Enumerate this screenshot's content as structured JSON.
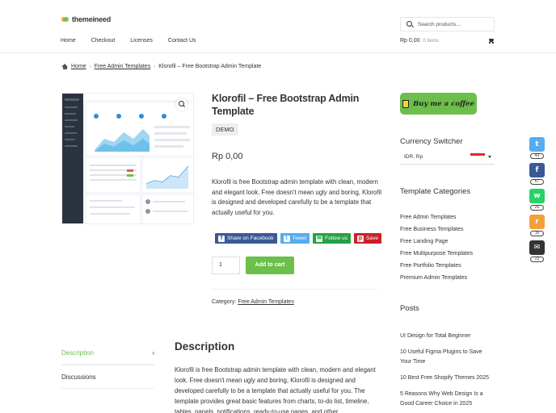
{
  "header": {
    "logo_text": "themeineed",
    "search_placeholder": "Search products…",
    "nav": [
      "Home",
      "Checkout",
      "Licenses",
      "Contact Us"
    ],
    "cart_price": "Rp 0,00",
    "cart_items": "0 items"
  },
  "breadcrumb": {
    "home": "Home",
    "parent": "Free Admin Templates",
    "current": "Klorofil – Free Bootstrap Admin Template",
    "separator": "›"
  },
  "product": {
    "title": "Klorofil – Free Bootstrap Admin Template",
    "demo_label": "DEMO",
    "price": "Rp 0,00",
    "description": "Klorofil is free Bootstrap admin template with clean, modern and elegant look. Free doesn't mean ugly and boring, Klorofil is designed and developed carefully to be a template that actually useful for you.",
    "quantity": "1",
    "add_to_cart": "Add to cart",
    "category_label": "Category:",
    "category_link": "Free Admin Templates",
    "shares": [
      {
        "label": "Share on Facebook",
        "icon": "f",
        "color": "#3b5998"
      },
      {
        "label": "Tweet",
        "icon": "t",
        "color": "#55acee"
      },
      {
        "label": "Follow us",
        "icon": "✉",
        "color": "#25a244"
      },
      {
        "label": "Save",
        "icon": "p",
        "color": "#cb2027"
      }
    ]
  },
  "sidebar": {
    "coffee": "Buy me a coffee",
    "currency_heading": "Currency Switcher",
    "currency_value": "IDR, Rp",
    "categories_heading": "Template Categories",
    "categories": [
      "Free Admin Templates",
      "Free Business Templates",
      "Free Landing Page",
      "Free Multipurpose Templates",
      "Free Portfolio Templates",
      "Premium Admin Templates"
    ],
    "posts_heading": "Posts",
    "posts": [
      "UI Design for Total Beginner",
      "10 Useful Figma Plugins to Save Your Time",
      "10 Best Free Shopify Themes 2025",
      "5 Reasons Why Web Design Is a Good Career Choice in 2025"
    ]
  },
  "tabs": [
    {
      "label": "Description",
      "chevron": "›"
    },
    {
      "label": "Discussions",
      "chevron": ""
    }
  ],
  "description_section": {
    "heading": "Description",
    "body": "Klorofil is free Bootstrap admin template with clean, modern and elegant look. Free doesn't mean ugly and boring, Klorofil is designed and developed carefully to be a template that actually useful for you. The template provides great basic features from charts, to-do list, timeline, tables, panels, notifications, ready-to-use pages, and other"
  },
  "floating_share": [
    {
      "icon": "t",
      "count": "43",
      "color": "#55acee"
    },
    {
      "icon": "f",
      "count": "67",
      "color": "#3b5998"
    },
    {
      "icon": "w",
      "count": "26",
      "color": "#25d366"
    },
    {
      "icon": "r",
      "count": "16",
      "color": "#f4a03a"
    },
    {
      "icon": "✉",
      "count": "23",
      "color": "#333333"
    }
  ],
  "colors": {
    "accent": "#6cbf4a",
    "text": "#333333"
  }
}
